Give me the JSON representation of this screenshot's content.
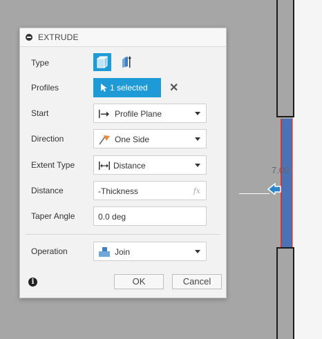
{
  "dialog": {
    "title": "EXTRUDE",
    "type_label": "Type",
    "profiles_label": "Profiles",
    "profiles_selected": "1 selected",
    "start_label": "Start",
    "start_value": "Profile Plane",
    "direction_label": "Direction",
    "direction_value": "One Side",
    "extent_label": "Extent Type",
    "extent_value": "Distance",
    "distance_label": "Distance",
    "distance_value": "-Thickness",
    "distance_fx": "fx",
    "taper_label": "Taper Angle",
    "taper_value": "0.0 deg",
    "operation_label": "Operation",
    "operation_value": "Join",
    "ok_label": "OK",
    "cancel_label": "Cancel"
  },
  "viewport": {
    "dimension_text": "7.00"
  },
  "colors": {
    "accent": "#1e9ad6",
    "body_blue": "#4c72b6",
    "edge_red": "#e03030"
  },
  "icons": {
    "collapse": "collapse-circle-icon",
    "extrude_solid": "extrude-solid-icon",
    "extrude_thin": "extrude-thin-icon",
    "cursor": "cursor-arrow-icon",
    "clear": "close-icon",
    "start": "profile-plane-icon",
    "direction": "one-side-flag-icon",
    "extent": "distance-icon",
    "operation": "join-icon",
    "info": "info-icon"
  }
}
